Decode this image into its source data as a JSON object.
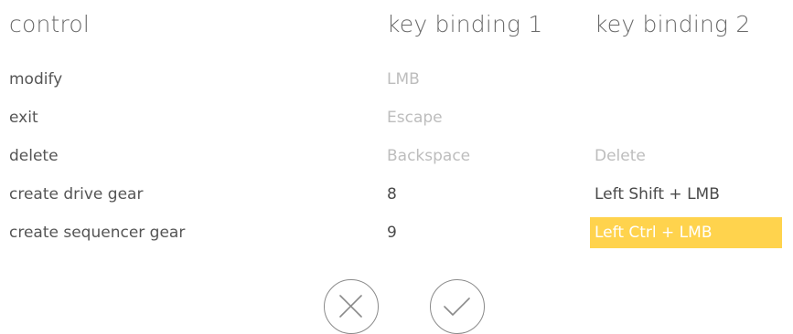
{
  "header": {
    "control_label": "control",
    "key1_label": "key binding 1",
    "key2_label": "key binding 2"
  },
  "bindings": [
    {
      "control": "modify",
      "key1": "LMB",
      "key1_state": "disabled",
      "key2": "",
      "key2_state": "empty"
    },
    {
      "control": "exit",
      "key1": "Escape",
      "key1_state": "disabled",
      "key2": "",
      "key2_state": "empty"
    },
    {
      "control": "delete",
      "key1": "Backspace",
      "key1_state": "disabled",
      "key2": "Delete",
      "key2_state": "disabled"
    },
    {
      "control": "create drive gear",
      "key1": "8",
      "key1_state": "enabled",
      "key2": "Left Shift + LMB",
      "key2_state": "enabled"
    },
    {
      "control": "create sequencer gear",
      "key1": "9",
      "key1_state": "enabled",
      "key2": "Left Ctrl + LMB",
      "key2_state": "selected"
    }
  ],
  "actions": {
    "cancel_icon": "close-icon",
    "confirm_icon": "check-icon"
  },
  "colors": {
    "highlight": "#ffd34d",
    "text": "#555555",
    "disabled_text": "#bdbdbd",
    "icon_stroke": "#8a8a8a"
  }
}
